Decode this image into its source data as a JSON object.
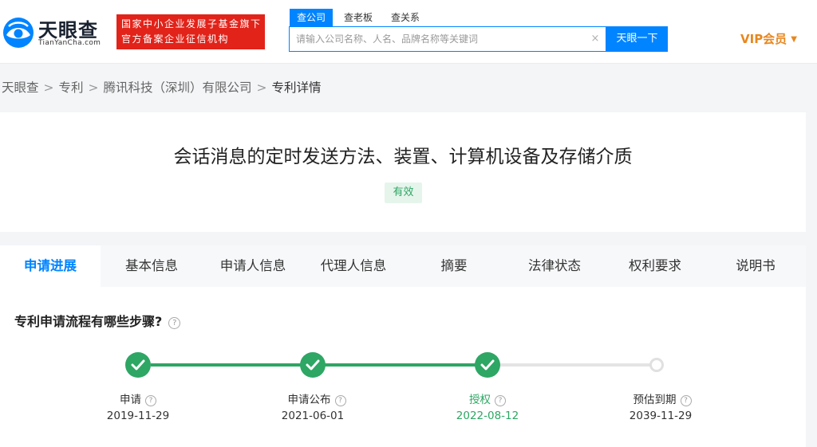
{
  "header": {
    "logo": {
      "name": "天眼查",
      "domain": "TianYanCha.com"
    },
    "gov_badge": {
      "line1": "国家中小企业发展子基金旗下",
      "line2": "官方备案企业征信机构"
    },
    "search": {
      "tabs": [
        "查公司",
        "查老板",
        "查关系"
      ],
      "placeholder": "请输入公司名称、人名、品牌名称等关键词",
      "clear_icon": "×",
      "button": "天眼一下"
    },
    "vip": {
      "label": "VIP会员",
      "caret": "▼"
    }
  },
  "breadcrumb": [
    "天眼查",
    "专利",
    "腾讯科技（深圳）有限公司",
    "专利详情"
  ],
  "breadcrumb_separator": ">",
  "patent": {
    "title": "会话消息的定时发送方法、装置、计算机设备及存储介质",
    "status": "有效"
  },
  "tabs": [
    "申请进展",
    "基本信息",
    "申请人信息",
    "代理人信息",
    "摘要",
    "法律状态",
    "权利要求",
    "说明书"
  ],
  "process": {
    "question": "专利申请流程有哪些步骤?",
    "help_glyph": "?",
    "steps": [
      {
        "label": "申请",
        "date": "2019-11-29",
        "state": "done"
      },
      {
        "label": "申请公布",
        "date": "2021-06-01",
        "state": "done"
      },
      {
        "label": "授权",
        "date": "2022-08-12",
        "state": "current"
      },
      {
        "label": "预估到期",
        "date": "2039-11-29",
        "state": "pending"
      }
    ]
  },
  "colors": {
    "brand_blue": "#0084ff",
    "success_green": "#2ea664",
    "vip_orange": "#e8871e",
    "badge_red": "#e2231a"
  },
  "icons": {
    "logo": "eye-logo-icon",
    "clear": "clear-icon",
    "vip_caret": "caret-down-icon",
    "help": "question-circle-icon",
    "step_done": "check-icon"
  }
}
